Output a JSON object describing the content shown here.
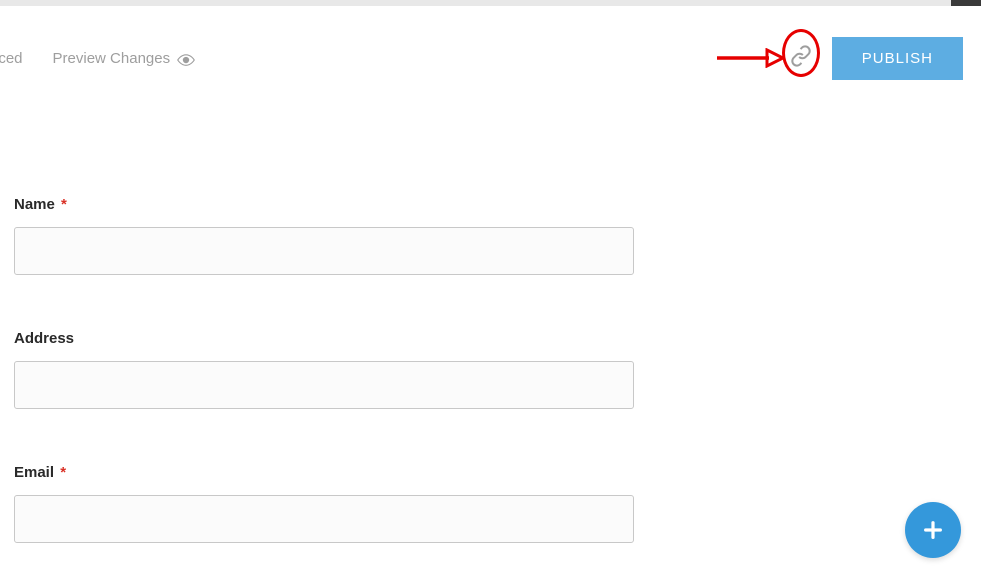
{
  "header": {
    "tab_partial": "nced",
    "preview_label": "Preview Changes",
    "publish_label": "PUBLISH"
  },
  "form": {
    "fields": [
      {
        "label": "Name",
        "required": true,
        "value": ""
      },
      {
        "label": "Address",
        "required": false,
        "value": ""
      },
      {
        "label": "Email",
        "required": true,
        "value": ""
      }
    ]
  },
  "required_marker": "*"
}
